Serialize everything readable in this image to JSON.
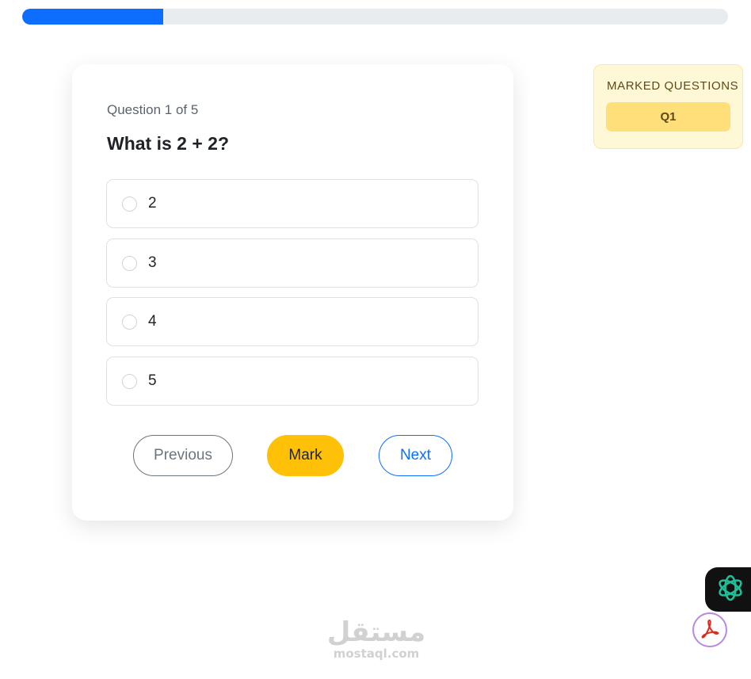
{
  "progress": {
    "value": 0.2,
    "color": "#0d6efd",
    "track_color": "#e9ecef"
  },
  "quiz": {
    "counter": "Question 1 of 5",
    "question": "What is 2 + 2?",
    "options": [
      {
        "label": "2",
        "selected": false
      },
      {
        "label": "3",
        "selected": false
      },
      {
        "label": "4",
        "selected": false
      },
      {
        "label": "5",
        "selected": false
      }
    ],
    "buttons": {
      "previous_label": "Previous",
      "mark_label": "Mark",
      "next_label": "Next"
    }
  },
  "marked_panel": {
    "title": "MARKED QUESTIONS",
    "items": [
      "Q1"
    ]
  },
  "floating": {
    "assistant_icon": "openai-logo-icon",
    "pdf_icon": "acrobat-pdf-icon"
  },
  "watermark": {
    "arabic": "مستقل",
    "latin": "mostaql.com"
  },
  "colors": {
    "accent": "#0d6efd",
    "warning": "#ffc107",
    "secondary": "#6c757d"
  }
}
